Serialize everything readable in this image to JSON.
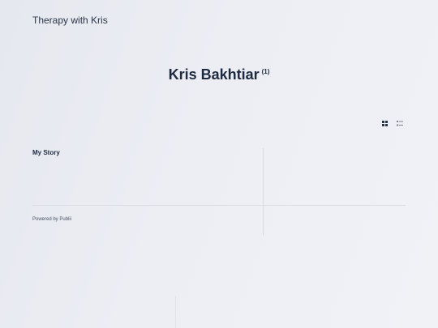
{
  "header": {
    "site_title": "Therapy with Kris"
  },
  "author": {
    "name": "Kris Bakhtiar",
    "post_count": "(1)"
  },
  "view_toggle": {
    "options": [
      "grid-view-icon",
      "list-view-icon"
    ],
    "active": "grid"
  },
  "posts": [
    {
      "title": "My Story"
    }
  ],
  "footer": {
    "powered_by": "Powered by Publii"
  },
  "colors": {
    "text": "#1e2a40",
    "divider": "#d9dbe2"
  }
}
